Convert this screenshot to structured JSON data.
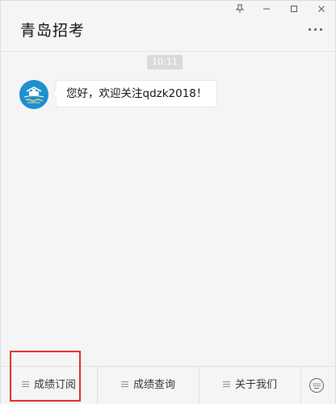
{
  "window": {
    "title": "青岛招考",
    "controls": {
      "pin": "📌",
      "minimize": "—",
      "maximize": "□",
      "close": "✕"
    }
  },
  "chat": {
    "timestamp": "10:11",
    "messages": [
      {
        "sender_avatar": "account-avatar",
        "text": "您好，欢迎关注qdzk2018！"
      }
    ]
  },
  "menu": {
    "items": [
      {
        "label": "成绩订阅",
        "highlighted": true
      },
      {
        "label": "成绩查询",
        "highlighted": false
      },
      {
        "label": "关于我们",
        "highlighted": false
      }
    ],
    "keyboard_icon": "keyboard-icon"
  },
  "colors": {
    "background": "#f5f5f5",
    "highlight_box": "#e12b2b",
    "avatar_blue": "#1e8fd0",
    "timestamp_bg": "#dadada"
  }
}
